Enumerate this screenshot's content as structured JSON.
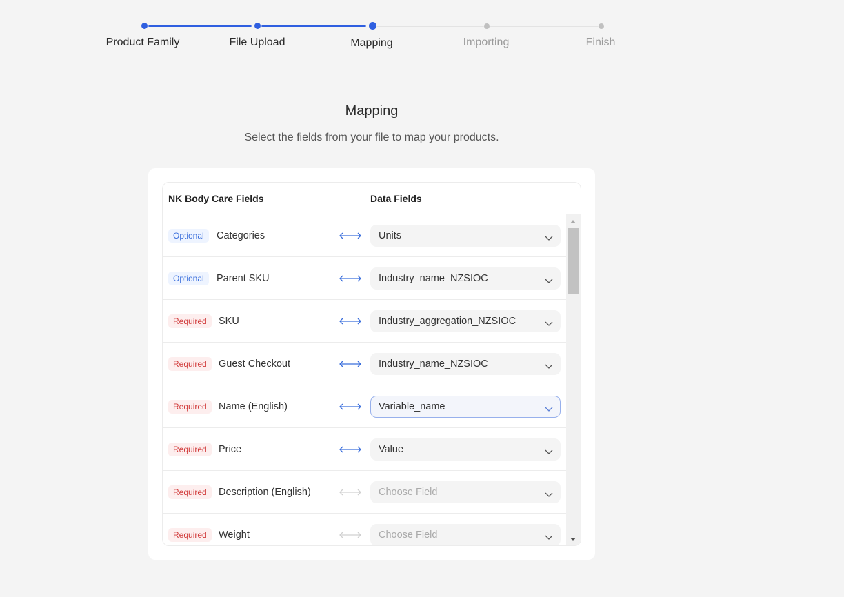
{
  "stepper": {
    "steps": [
      {
        "label": "Product Family",
        "state": "done"
      },
      {
        "label": "File Upload",
        "state": "done"
      },
      {
        "label": "Mapping",
        "state": "current"
      },
      {
        "label": "Importing",
        "state": "todo"
      },
      {
        "label": "Finish",
        "state": "todo"
      }
    ]
  },
  "page": {
    "title": "Mapping",
    "subtitle": "Select the fields from your file to map your products."
  },
  "table": {
    "left_header": "NK Body Care Fields",
    "right_header": "Data Fields",
    "rows": [
      {
        "badge": "Optional",
        "badge_type": "optional",
        "field": "Categories",
        "mapped": true,
        "value": "Units",
        "placeholder": false,
        "focused": false
      },
      {
        "badge": "Optional",
        "badge_type": "optional",
        "field": "Parent SKU",
        "mapped": true,
        "value": "Industry_name_NZSIOC",
        "placeholder": false,
        "focused": false
      },
      {
        "badge": "Required",
        "badge_type": "required",
        "field": "SKU",
        "mapped": true,
        "value": "Industry_aggregation_NZSIOC",
        "placeholder": false,
        "focused": false
      },
      {
        "badge": "Required",
        "badge_type": "required",
        "field": "Guest Checkout",
        "mapped": true,
        "value": "Industry_name_NZSIOC",
        "placeholder": false,
        "focused": false
      },
      {
        "badge": "Required",
        "badge_type": "required",
        "field": "Name (English)",
        "mapped": true,
        "value": "Variable_name",
        "placeholder": false,
        "focused": true
      },
      {
        "badge": "Required",
        "badge_type": "required",
        "field": "Price",
        "mapped": true,
        "value": "Value",
        "placeholder": false,
        "focused": false
      },
      {
        "badge": "Required",
        "badge_type": "required",
        "field": "Description (English)",
        "mapped": false,
        "value": "Choose Field",
        "placeholder": true,
        "focused": false
      },
      {
        "badge": "Required",
        "badge_type": "required",
        "field": "Weight",
        "mapped": false,
        "value": "Choose Field",
        "placeholder": true,
        "focused": false
      }
    ]
  },
  "colors": {
    "accent": "#2f5fe0",
    "arrow_active": "#3b6fdc",
    "arrow_inactive": "#d0d0d0"
  },
  "icons": {
    "row_arrow": "double-arrow-icon",
    "dropdown": "chevron-down-icon"
  }
}
